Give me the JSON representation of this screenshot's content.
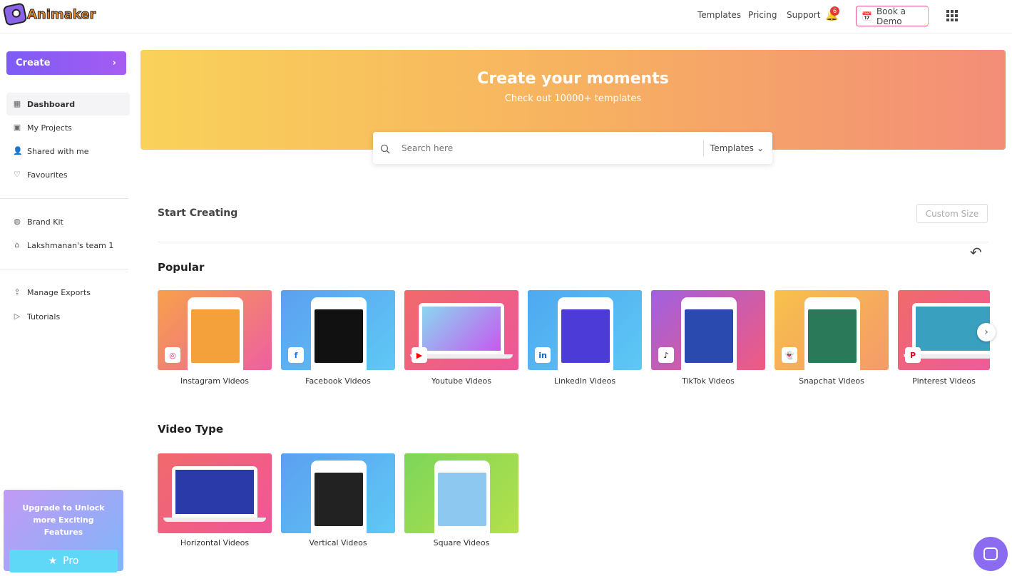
{
  "app": {
    "logo_text": "Animaker"
  },
  "header": {
    "nav": [
      "Templates",
      "Pricing",
      "Support"
    ],
    "notifications": "6",
    "book_demo": "Book a Demo"
  },
  "sidebar": {
    "create": "Create",
    "items": [
      {
        "label": "Dashboard",
        "icon": "grid-icon",
        "active": true
      },
      {
        "label": "My Projects",
        "icon": "projects-icon"
      },
      {
        "label": "Shared with me",
        "icon": "user-icon"
      },
      {
        "label": "Favourites",
        "icon": "heart-icon"
      }
    ],
    "items2": [
      {
        "label": "Brand Kit",
        "icon": "brand-icon"
      },
      {
        "label": "Lakshmanan's team 1",
        "icon": "team-icon"
      }
    ],
    "items3": [
      {
        "label": "Manage Exports",
        "icon": "export-icon"
      },
      {
        "label": "Tutorials",
        "icon": "tutorial-icon"
      }
    ],
    "upgrade": {
      "text": "Upgrade to Unlock more Exciting Features",
      "button": "Pro"
    }
  },
  "banner": {
    "title": "Create your moments",
    "subtitle": "Check out 10000+ templates"
  },
  "search": {
    "placeholder": "Search here",
    "filter": "Templates"
  },
  "main": {
    "start_creating": "Start Creating",
    "custom_size": "Custom Size",
    "popular_title": "Popular",
    "popular": [
      {
        "label": "Instagram Videos",
        "badge": "◎",
        "bg": "linear-gradient(135deg,#f7a14a,#ee5fa0)",
        "screen": "#f4a13c",
        "badge_color": "#e1306c"
      },
      {
        "label": "Facebook Videos",
        "badge": "f",
        "bg": "linear-gradient(135deg,#5b9ff0,#5fc9f5)",
        "screen": "#111",
        "badge_color": "#1877f2"
      },
      {
        "label": "Youtube Videos",
        "badge": "▶",
        "bg": "linear-gradient(135deg,#f06a6a,#f0569a)",
        "screen": "linear-gradient(135deg,#8bd7f0,#c55af0)",
        "badge_color": "#ff0000",
        "type": "laptop"
      },
      {
        "label": "LinkedIn Videos",
        "badge": "in",
        "bg": "linear-gradient(135deg,#4ea8f0,#5ec8f5)",
        "screen": "#4c3bd6",
        "badge_color": "#0a66c2"
      },
      {
        "label": "TikTok Videos",
        "badge": "♪",
        "bg": "linear-gradient(135deg,#a060e0,#f05a80)",
        "screen": "#2a4ab0",
        "badge_color": "#000"
      },
      {
        "label": "Snapchat Videos",
        "badge": "👻",
        "bg": "linear-gradient(135deg,#f7c14a,#f59a6a)",
        "screen": "#2a7a5a",
        "badge_color": "#000"
      },
      {
        "label": "Pinterest Videos",
        "badge": "P",
        "bg": "linear-gradient(135deg,#f06a6a,#f05a9a)",
        "screen": "#3aa0c0",
        "badge_color": "#e60023",
        "type": "laptop"
      }
    ],
    "video_type_title": "Video Type",
    "video_types": [
      {
        "label": "Horizontal Videos",
        "bg": "linear-gradient(135deg,#f06a6a,#f0569a)",
        "screen": "#2a3aa8",
        "type": "laptop"
      },
      {
        "label": "Vertical Videos",
        "bg": "linear-gradient(135deg,#5b9ff0,#5fc9f5)",
        "screen": "#222"
      },
      {
        "label": "Square Videos",
        "bg": "linear-gradient(135deg,#7cd65a,#b5e04a)",
        "screen": "#8cc8f0"
      }
    ]
  }
}
